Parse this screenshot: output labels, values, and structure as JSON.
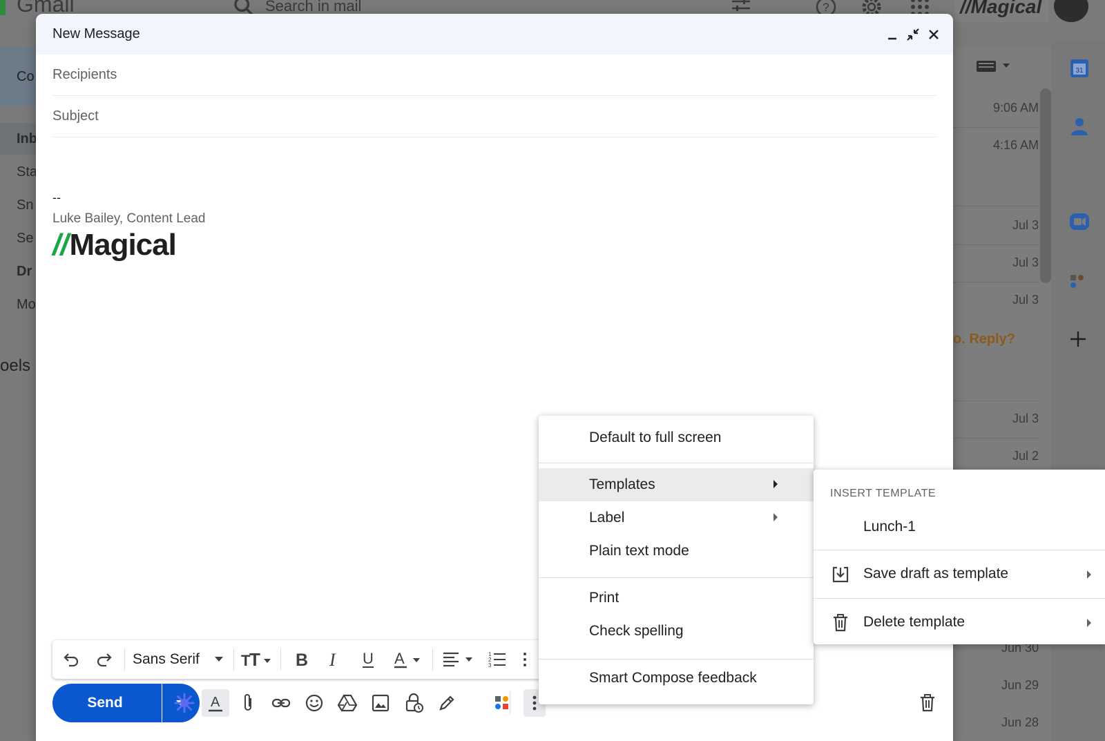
{
  "background": {
    "brand": "Gmail",
    "search_placeholder": "Search in mail",
    "compose_label": "Co",
    "nav": [
      "Inb",
      "Sta",
      "Sn",
      "Se",
      "Dr",
      "Mo"
    ],
    "labels_heading": "oels",
    "logo_text": "//Magical",
    "reply_snippet": "o. Reply?",
    "times": [
      "9:06 AM",
      "4:16 AM",
      "Jul 3",
      "Jul 3",
      "Jul 3",
      "Jul 3",
      "Jul 2",
      "Jun 30",
      "Jun 29",
      "Jun 28"
    ]
  },
  "compose": {
    "title": "New Message",
    "recipients_placeholder": "Recipients",
    "subject_placeholder": "Subject",
    "signature": {
      "dash": "--",
      "name": "Luke Bailey, Content Lead",
      "logo_slash": "//",
      "logo_word": "Magical"
    },
    "toolbar": {
      "font": "Sans Serif"
    },
    "send_label": "Send"
  },
  "menu": {
    "items": [
      {
        "label": "Default to full screen"
      },
      {
        "label": "Templates"
      },
      {
        "label": "Label"
      },
      {
        "label": "Plain text mode"
      },
      {
        "label": "Print"
      },
      {
        "label": "Check spelling"
      },
      {
        "label": "Smart Compose feedback"
      }
    ]
  },
  "submenu": {
    "heading": "INSERT TEMPLATE",
    "template": "Lunch-1",
    "save": "Save draft as template",
    "delete": "Delete template"
  },
  "colors": {
    "primary": "#0b57d0",
    "header_bg": "#f2f6fc",
    "logo_green": "#19a74a"
  }
}
